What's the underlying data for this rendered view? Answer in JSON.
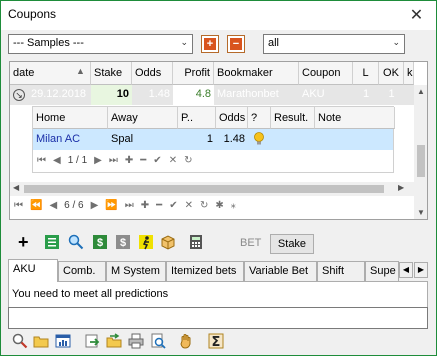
{
  "window": {
    "title": "Coupons"
  },
  "toolbar": {
    "samples_value": "--- Samples ---",
    "filter_value": "all",
    "add_label": "+",
    "remove_label": "−"
  },
  "grid": {
    "columns": [
      "date",
      "Stake",
      "Odds",
      "Profit",
      "Bookmaker",
      "Coupon",
      "L",
      "OK",
      "k"
    ],
    "row": {
      "date": "29.12.2018",
      "stake": "10",
      "odds": "1.48",
      "profit": "4.8",
      "bookmaker": "Marathonbet",
      "coupon": "AKU",
      "l": "1",
      "ok": "1"
    },
    "detail": {
      "columns": [
        "Home",
        "Away",
        "P..",
        "Odds",
        "?",
        "Result.",
        "Note"
      ],
      "row": {
        "home": "Milan AC",
        "away": "Spal",
        "p": "1",
        "odds": "1.48"
      },
      "nav_position": "1 / 1"
    },
    "nav_position": "6 / 6"
  },
  "actions": {
    "bet_label": "BET",
    "stake_button": "Stake"
  },
  "tabs": [
    "AKU",
    "Comb.",
    "M System",
    "Itemized bets",
    "Variable Bet",
    "Shift",
    "Supe"
  ],
  "active_tab_message": "You need to meet all predictions",
  "note_value": "",
  "colors": {
    "row_highlight": "#e6e6e6",
    "detail_highlight": "#cce8ff",
    "link_text": "#1a2fa8",
    "stake_cell": "#e8f6e0",
    "green_profit": "#3a7d2a"
  }
}
